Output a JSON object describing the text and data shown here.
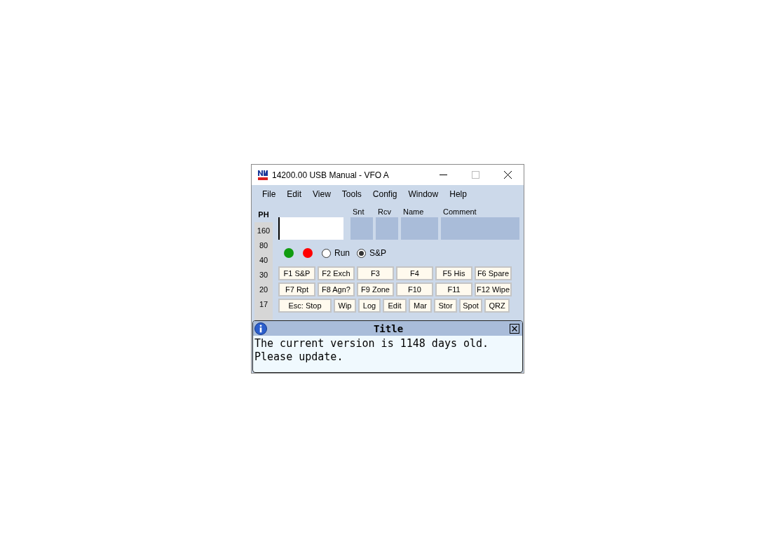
{
  "window": {
    "title": "14200.00 USB Manual - VFO A"
  },
  "menu": [
    "File",
    "Edit",
    "View",
    "Tools",
    "Config",
    "Window",
    "Help"
  ],
  "mode": "PH",
  "bands": [
    "160",
    "80",
    "40",
    "30",
    "20",
    "17"
  ],
  "entry_columns": [
    {
      "kind": "call"
    },
    {
      "label": "Snt",
      "kind": "small"
    },
    {
      "label": "Rcv",
      "kind": "small"
    },
    {
      "label": "Name",
      "kind": "name"
    },
    {
      "label": "Comment",
      "kind": "comment"
    }
  ],
  "indicators": [
    {
      "color": "#109c10"
    },
    {
      "color": "#ff0000"
    }
  ],
  "radios": [
    {
      "label": "Run",
      "selected": false
    },
    {
      "label": "S&P",
      "selected": true
    }
  ],
  "function_keys": [
    [
      "F1 S&P",
      "F2 Exch",
      "F3",
      "F4",
      "F5 His",
      "F6 Spare"
    ],
    [
      "F7 Rpt",
      "F8 Agn?",
      "F9 Zone",
      "F10",
      "F11",
      "F12 Wipe"
    ],
    [
      "Esc: Stop",
      "Wip",
      "Log",
      "Edit",
      "Mar",
      "Stor",
      "Spot",
      "QRZ"
    ]
  ],
  "popup": {
    "title": "Title",
    "lines": [
      "The current version is 1148 days old.",
      "Please update."
    ]
  }
}
